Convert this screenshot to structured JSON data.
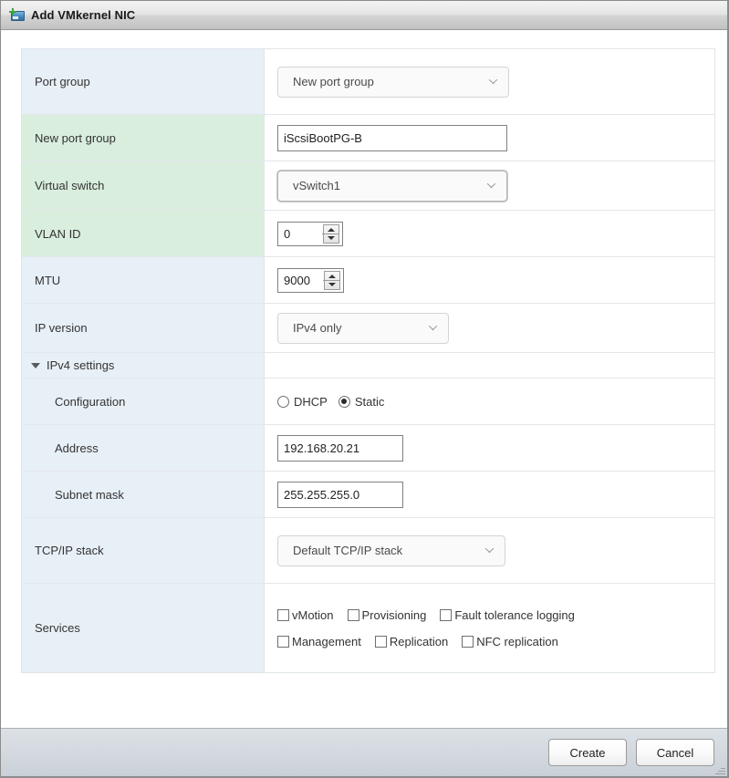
{
  "window": {
    "title": "Add VMkernel NIC",
    "icon": "vmkernel-nic-icon"
  },
  "form": {
    "rows": [
      {
        "label": "Port group",
        "value": "New port group"
      },
      {
        "label": "New port group",
        "value": "iScsiBootPG-B"
      },
      {
        "label": "Virtual switch",
        "value": "vSwitch1"
      },
      {
        "label": "VLAN ID",
        "value": "0"
      },
      {
        "label": "MTU",
        "value": "9000"
      },
      {
        "label": "IP version",
        "value": "IPv4 only"
      },
      {
        "label": "IPv4 settings"
      },
      {
        "label": "Configuration"
      },
      {
        "label": "Address",
        "value": "192.168.20.21"
      },
      {
        "label": "Subnet mask",
        "value": "255.255.255.0"
      },
      {
        "label": "TCP/IP stack",
        "value": "Default TCP/IP stack"
      },
      {
        "label": "Services"
      }
    ],
    "configuration": {
      "dhcp_label": "DHCP",
      "static_label": "Static",
      "selected": "Static"
    },
    "services": {
      "row1": [
        {
          "label": "vMotion",
          "checked": false
        },
        {
          "label": "Provisioning",
          "checked": false
        },
        {
          "label": "Fault tolerance logging",
          "checked": false
        }
      ],
      "row2": [
        {
          "label": "Management",
          "checked": false
        },
        {
          "label": "Replication",
          "checked": false
        },
        {
          "label": "NFC replication",
          "checked": false
        }
      ]
    }
  },
  "footer": {
    "create_label": "Create",
    "cancel_label": "Cancel"
  },
  "colors": {
    "row_blue": "#e8f0f7",
    "row_green": "#d9eedd",
    "titlebar": "#d3d3d3",
    "footer": "#d3d9df"
  }
}
